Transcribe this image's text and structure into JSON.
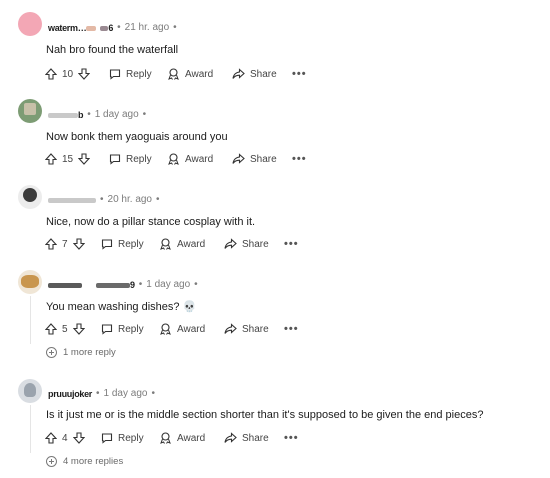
{
  "comments": [
    {
      "username": "waterm…",
      "username_suffix": "6",
      "age": "21 hr. ago",
      "text": "Nah bro found the waterfall",
      "votes": "10",
      "reply": "Reply",
      "award": "Award",
      "share": "Share",
      "more": "•••",
      "avatar_color": "#f3a7b5"
    },
    {
      "username": "b",
      "age": "1 day ago",
      "text": "Now bonk them yaoguais around you",
      "votes": "15",
      "reply": "Reply",
      "award": "Award",
      "share": "Share",
      "more": "•••",
      "avatar_color": "#7d9c74"
    },
    {
      "username": "",
      "age": "20 hr. ago",
      "text": "Nice, now do a pillar stance cosplay with it.",
      "votes": "7",
      "reply": "Reply",
      "award": "Award",
      "share": "Share",
      "more": "•••",
      "avatar_color": "#3b3b3b"
    },
    {
      "username": "9",
      "age": "1 day ago",
      "text": "You mean washing dishes? 💀",
      "votes": "5",
      "reply": "Reply",
      "award": "Award",
      "share": "Share",
      "more": "•••",
      "more_replies": "1 more reply",
      "avatar_color": "#c9964e"
    },
    {
      "username": "pruuujoker",
      "age": "1 day ago",
      "text": "Is it just me or is the middle section shorter than it's supposed to be given the end pieces?",
      "votes": "4",
      "reply": "Reply",
      "award": "Award",
      "share": "Share",
      "more": "•••",
      "more_replies": "4 more replies",
      "avatar_color": "#9aa3ad"
    }
  ],
  "separator": "•"
}
